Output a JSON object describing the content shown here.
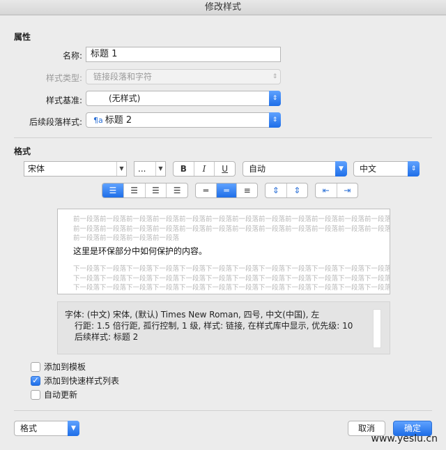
{
  "window": {
    "title": "修改样式"
  },
  "properties": {
    "section_title": "属性",
    "name_label": "名称:",
    "name_value": "标题 1",
    "style_type_label": "样式类型:",
    "style_type_value": "链接段落和字符",
    "based_on_label": "样式基准:",
    "based_on_value": "(无样式)",
    "next_style_label": "后续段落样式:",
    "next_style_icon": "¶a",
    "next_style_value": "标题 2"
  },
  "format": {
    "section_title": "格式",
    "font_value": "宋体",
    "size_value": "...",
    "bold_label": "B",
    "italic_label": "I",
    "underline_label": "U",
    "color_value": "自动",
    "script_value": "中文"
  },
  "preview": {
    "prev_line": "前一段落前一段落前一段落前一段落前一段落前一段落前一段落前一段落前一段落前一段落前一段落前一段落",
    "prev_last": "前一段落前一段落前一段落前一段落",
    "sample_text": "这里是环保部分中如何保护的内容。",
    "next_line": "下一段落下一段落下一段落下一段落下一段落下一段落下一段落下一段落下一段落下一段落下一段落下一段落"
  },
  "description": {
    "line1": "字体: (中文) 宋体, (默认) Times New Roman, 四号, 中文(中国), 左",
    "line2": "行距: 1.5 倍行距, 孤行控制, 1 级, 样式: 链接, 在样式库中显示, 优先级: 10",
    "line3": "后续样式: 标题 2"
  },
  "options": {
    "add_to_template": "添加到模板",
    "add_to_template_checked": false,
    "add_to_quick_styles": "添加到快速样式列表",
    "add_to_quick_styles_checked": true,
    "auto_update": "自动更新",
    "auto_update_checked": false
  },
  "footer": {
    "format_menu": "格式",
    "cancel_label": "取消",
    "ok_label": "确定"
  },
  "watermark": "www.yeslu.cn"
}
